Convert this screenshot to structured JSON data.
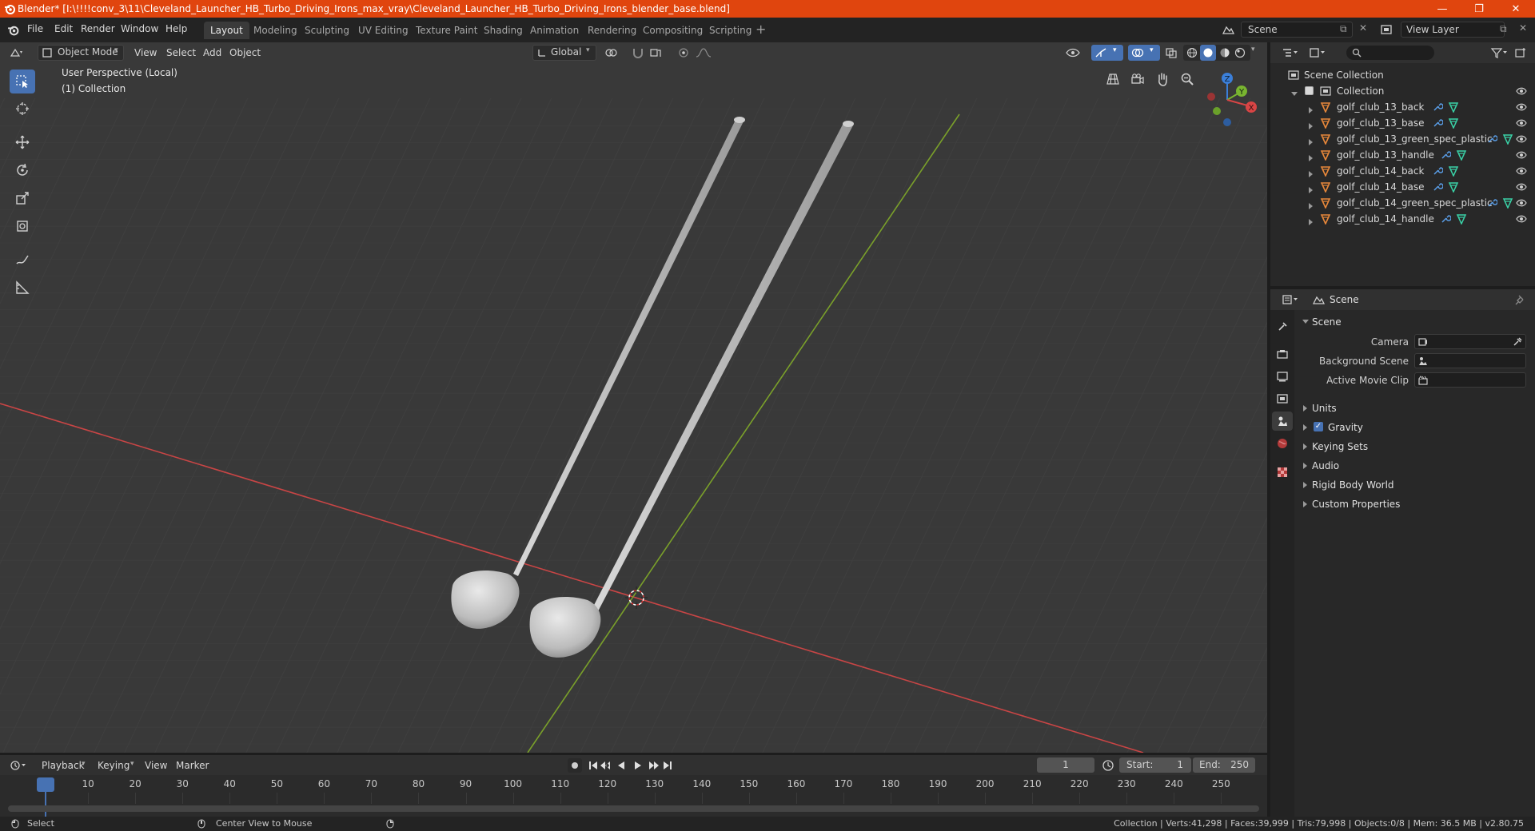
{
  "window": {
    "title": "Blender* [I:\\!!!!conv_3\\11\\Cleveland_Launcher_HB_Turbo_Driving_Irons_max_vray\\Cleveland_Launcher_HB_Turbo_Driving_Irons_blender_base.blend]",
    "minimize": "—",
    "maximize": "❐",
    "close": "✕"
  },
  "menu": [
    "File",
    "Edit",
    "Render",
    "Window",
    "Help"
  ],
  "workspaces": [
    "Layout",
    "Modeling",
    "Sculpting",
    "UV Editing",
    "Texture Paint",
    "Shading",
    "Animation",
    "Rendering",
    "Compositing",
    "Scripting"
  ],
  "active_workspace": "Layout",
  "scene_field": "Scene",
  "view_layer_field": "View Layer",
  "viewport": {
    "mode": "Object Mode",
    "menus": [
      "View",
      "Select",
      "Add",
      "Object"
    ],
    "transform_orientation": "Global",
    "overlay_title": "User Perspective (Local)",
    "overlay_collection": "(1) Collection",
    "gizmo_axes": {
      "z": "Z",
      "y": "Y",
      "x": "X"
    }
  },
  "outliner": {
    "root": "Scene Collection",
    "collection": "Collection",
    "items": [
      "golf_club_13_back",
      "golf_club_13_base",
      "golf_club_13_green_spec_plastic",
      "golf_club_13_handle",
      "golf_club_14_back",
      "golf_club_14_base",
      "golf_club_14_green_spec_plastic",
      "golf_club_14_handle"
    ]
  },
  "properties": {
    "header": "Scene",
    "section": "Scene",
    "fields": [
      {
        "label": "Camera",
        "value": ""
      },
      {
        "label": "Background Scene",
        "value": ""
      },
      {
        "label": "Active Movie Clip",
        "value": ""
      }
    ],
    "panels": [
      "Units",
      "Gravity",
      "Keying Sets",
      "Audio",
      "Rigid Body World",
      "Custom Properties"
    ],
    "gravity_checked": true
  },
  "timeline": {
    "menus": [
      "Playback",
      "Keying",
      "View",
      "Marker"
    ],
    "current_frame": "1",
    "start_label": "Start:",
    "start": "1",
    "end_label": "End:",
    "end": "250",
    "ticks": [
      "1",
      "10",
      "20",
      "30",
      "40",
      "50",
      "60",
      "70",
      "80",
      "90",
      "100",
      "110",
      "120",
      "130",
      "140",
      "150",
      "160",
      "170",
      "180",
      "190",
      "200",
      "210",
      "220",
      "230",
      "240",
      "250"
    ]
  },
  "statusbar": {
    "left": "Select",
    "middle": "Center View to Mouse",
    "right": "Collection | Verts:41,298 | Faces:39,999 | Tris:79,998 | Objects:0/8 | Mem: 36.5 MB | v2.80.75"
  },
  "colors": {
    "title_bar": "#e0450e",
    "accent": "#4772b3",
    "x_axis": "#c84545",
    "y_axis": "#7aa02a"
  }
}
